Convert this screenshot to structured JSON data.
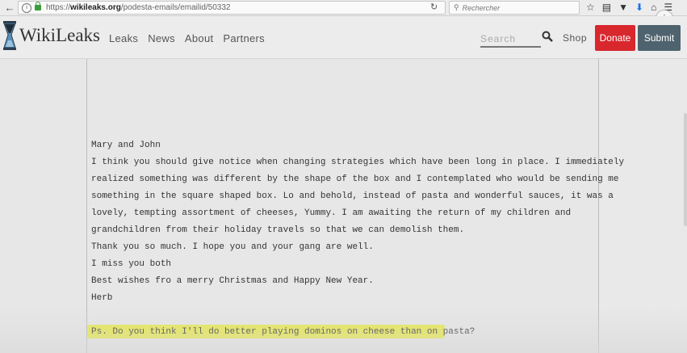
{
  "browser": {
    "url_prefix": "https://",
    "url_domain": "wikileaks.org",
    "url_path": "/podesta-emails/emailid/50332",
    "search_placeholder": "Rechercher",
    "info_glyph": "i"
  },
  "header": {
    "brand": "WikiLeaks",
    "nav": [
      "Leaks",
      "News",
      "About",
      "Partners"
    ],
    "search_placeholder": "Search",
    "shop_label": "Shop",
    "donate_label": "Donate",
    "submit_label": "Submit",
    "colors": {
      "donate": "#d9272e",
      "submit": "#4f636e"
    }
  },
  "email": {
    "lines": [
      "Mary and John",
      "I think you should give notice when changing strategies which have been long in place. I immediately",
      "realized something was different by the shape of the box and I contemplated who would be sending me",
      "something in the square shaped box. Lo and behold, instead of pasta and wonderful sauces, it was a",
      "lovely, tempting assortment of cheeses, Yummy. I am awaiting the return of my children and",
      "grandchildren from their holiday travels so that we can demolish them.",
      "Thank you so much. I hope you and your gang are well.",
      "I miss you both",
      "Best wishes fro a merry Christmas and Happy New Year.",
      "Herb"
    ],
    "ps": "Ps. Do you think I'll do better playing dominos on cheese than on pasta?",
    "highlight_color": "#e8ea3c"
  }
}
